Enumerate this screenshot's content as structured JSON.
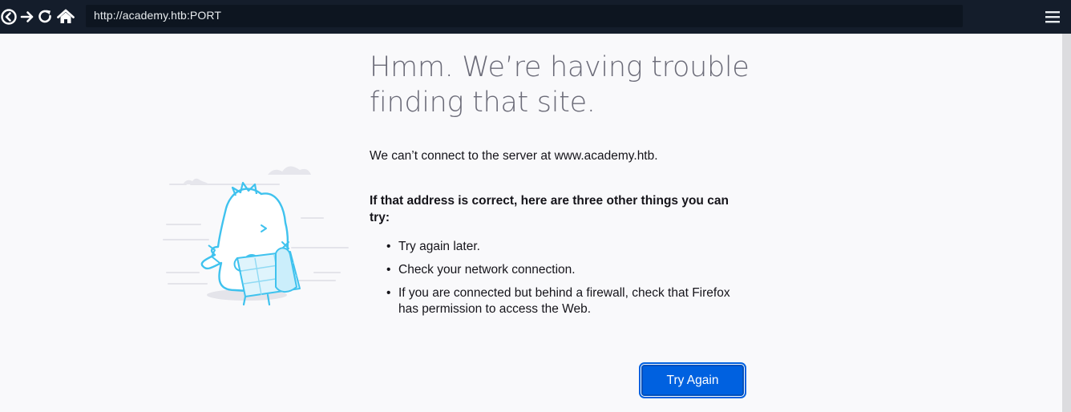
{
  "browser": {
    "url": "http://academy.htb:PORT",
    "nav": {
      "back_icon": "back-circle-icon",
      "forward_icon": "forward-arrow-icon",
      "reload_icon": "reload-icon",
      "home_icon": "home-icon",
      "menu_icon": "hamburger-menu-icon"
    }
  },
  "error_page": {
    "title_line1": "Hmm. We’re having trouble",
    "title_line2": "finding that site.",
    "message": "We can’t connect to the server at www.academy.htb.",
    "suggestions_heading": "If that address is correct, here are three other things you can try:",
    "suggestions": [
      "Try again later.",
      "Check your network connection.",
      "If you are connected but behind a firewall, check that Firefox has permission to access the Web."
    ],
    "button_label": "Try Again"
  },
  "colors": {
    "toolbar": "#141d2b",
    "accent": "#0061e0",
    "page_bg": "#f9f9fb",
    "title": "#6b6b78"
  }
}
